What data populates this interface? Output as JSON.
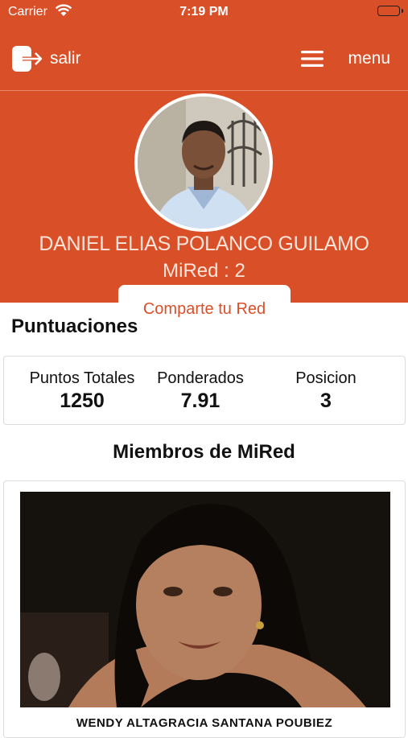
{
  "status_bar": {
    "carrier": "Carrier",
    "time": "7:19 PM"
  },
  "nav": {
    "logout_label": "salir",
    "menu_label": "menu"
  },
  "profile": {
    "name": "DANIEL ELIAS POLANCO GUILAMO",
    "network_count": "MiRed : 2",
    "share_label": "Comparte tu Red"
  },
  "scores": {
    "title": "Puntuaciones",
    "items": [
      {
        "label": "Puntos Totales",
        "value": "1250"
      },
      {
        "label": "Ponderados",
        "value": "7.91"
      },
      {
        "label": "Posicion",
        "value": "3"
      }
    ]
  },
  "members": {
    "title": "Miembros de MiRed",
    "list": [
      {
        "name": "WENDY ALTAGRACIA SANTANA POUBIEZ"
      }
    ]
  },
  "colors": {
    "primary": "#d94f28",
    "header_text": "#fbe4da"
  }
}
